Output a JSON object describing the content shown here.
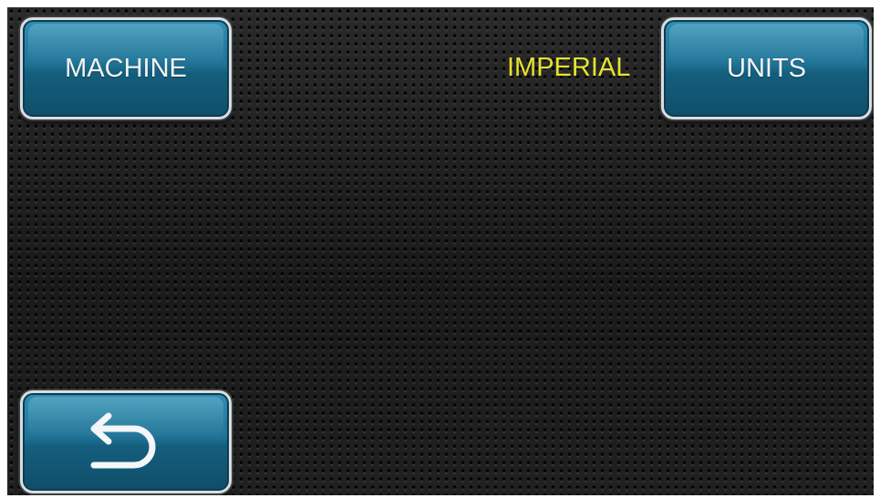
{
  "buttons": {
    "machine_label": "MACHINE",
    "units_label": "UNITS"
  },
  "settings": {
    "units_value": "IMPERIAL"
  },
  "icons": {
    "back": "back-arrow-icon"
  },
  "colors": {
    "button_blue": "#1f7396",
    "button_border": "#d9dde0",
    "value_text": "#e6e22e",
    "background": "#1c1c1c"
  }
}
